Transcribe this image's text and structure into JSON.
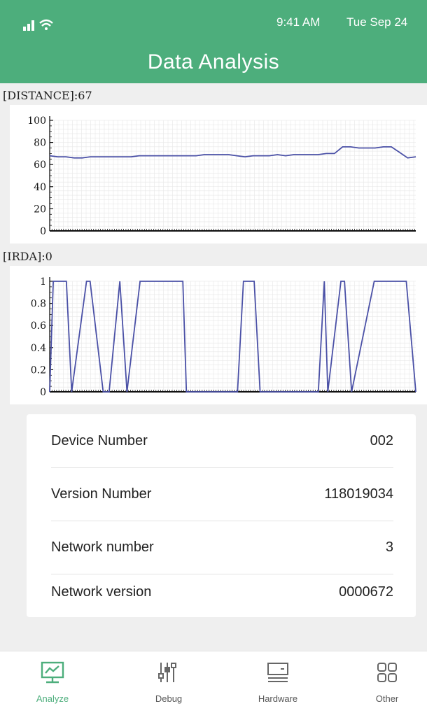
{
  "status_bar": {
    "time": "9:41 AM",
    "date": "Tue Sep 24"
  },
  "header": {
    "title": "Data Analysis"
  },
  "colors": {
    "header_bg": "#4dae7c",
    "line": "#4a50a6",
    "accent": "#4dae7c"
  },
  "distance": {
    "label": "[DISTANCE]:67",
    "chart_data": {
      "type": "line",
      "ylim": [
        0,
        100
      ],
      "ticks": [
        "0",
        "20",
        "40",
        "60",
        "80",
        "100"
      ],
      "grid": true,
      "values": [
        68,
        67,
        67,
        66,
        66,
        67,
        67,
        67,
        67,
        67,
        67,
        68,
        68,
        68,
        68,
        68,
        68,
        68,
        68,
        69,
        69,
        69,
        69,
        68,
        67,
        68,
        68,
        68,
        69,
        68,
        69,
        69,
        69,
        69,
        70,
        70,
        76,
        76,
        75,
        75,
        75,
        76,
        76,
        71,
        66,
        67
      ]
    }
  },
  "irda": {
    "label": "[IRDA]:0",
    "chart_data": {
      "type": "line",
      "ylim": [
        0,
        1
      ],
      "ticks": [
        "0",
        "0.2",
        "0.4",
        "0.6",
        "0.8",
        "1"
      ],
      "grid": true,
      "x": [
        0,
        0.3,
        1.4,
        1.85,
        3.1,
        3.4,
        4.5,
        5.0,
        5.9,
        6.5,
        7.6,
        7.8,
        11.2,
        11.5,
        15.8,
        16.3,
        17.2,
        17.7,
        22.6,
        23.1,
        23.4,
        24.5,
        24.8,
        25.4,
        27.3,
        27.8,
        30.0,
        30.8
      ],
      "values": [
        0,
        1,
        1,
        0,
        1,
        1,
        0,
        0,
        1,
        0,
        1,
        1,
        1,
        0,
        0,
        1,
        1,
        0,
        0,
        1,
        0,
        1,
        1,
        0,
        1,
        1,
        1,
        0
      ],
      "xmax": 30.8
    }
  },
  "info": {
    "rows": [
      {
        "label": "Device Number",
        "value": "002"
      },
      {
        "label": "Version Number",
        "value": "118019034"
      },
      {
        "label": "Network number",
        "value": "3"
      },
      {
        "label": "Network version",
        "value": "0000672"
      }
    ]
  },
  "tabs": [
    {
      "label": "Analyze",
      "icon": "analyze-icon",
      "active": true
    },
    {
      "label": "Debug",
      "icon": "debug-icon"
    },
    {
      "label": "Hardware",
      "icon": "hardware-icon"
    },
    {
      "label": "Other",
      "icon": "other-icon"
    }
  ]
}
